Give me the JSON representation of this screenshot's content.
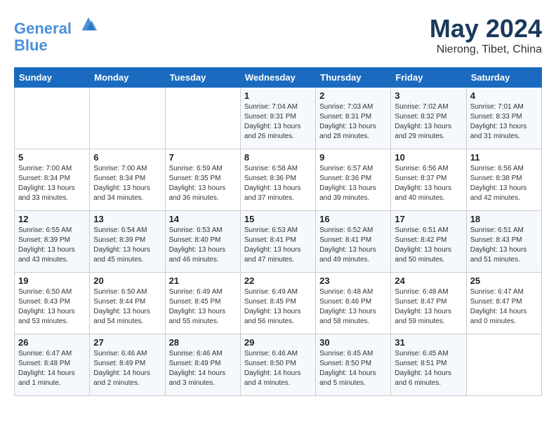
{
  "header": {
    "logo_line1": "General",
    "logo_line2": "Blue",
    "month_title": "May 2024",
    "subtitle": "Nierong, Tibet, China"
  },
  "days_of_week": [
    "Sunday",
    "Monday",
    "Tuesday",
    "Wednesday",
    "Thursday",
    "Friday",
    "Saturday"
  ],
  "weeks": [
    [
      {
        "day": "",
        "info": ""
      },
      {
        "day": "",
        "info": ""
      },
      {
        "day": "",
        "info": ""
      },
      {
        "day": "1",
        "info": "Sunrise: 7:04 AM\nSunset: 8:31 PM\nDaylight: 13 hours\nand 26 minutes."
      },
      {
        "day": "2",
        "info": "Sunrise: 7:03 AM\nSunset: 8:31 PM\nDaylight: 13 hours\nand 28 minutes."
      },
      {
        "day": "3",
        "info": "Sunrise: 7:02 AM\nSunset: 8:32 PM\nDaylight: 13 hours\nand 29 minutes."
      },
      {
        "day": "4",
        "info": "Sunrise: 7:01 AM\nSunset: 8:33 PM\nDaylight: 13 hours\nand 31 minutes."
      }
    ],
    [
      {
        "day": "5",
        "info": "Sunrise: 7:00 AM\nSunset: 8:34 PM\nDaylight: 13 hours\nand 33 minutes."
      },
      {
        "day": "6",
        "info": "Sunrise: 7:00 AM\nSunset: 8:34 PM\nDaylight: 13 hours\nand 34 minutes."
      },
      {
        "day": "7",
        "info": "Sunrise: 6:59 AM\nSunset: 8:35 PM\nDaylight: 13 hours\nand 36 minutes."
      },
      {
        "day": "8",
        "info": "Sunrise: 6:58 AM\nSunset: 8:36 PM\nDaylight: 13 hours\nand 37 minutes."
      },
      {
        "day": "9",
        "info": "Sunrise: 6:57 AM\nSunset: 8:36 PM\nDaylight: 13 hours\nand 39 minutes."
      },
      {
        "day": "10",
        "info": "Sunrise: 6:56 AM\nSunset: 8:37 PM\nDaylight: 13 hours\nand 40 minutes."
      },
      {
        "day": "11",
        "info": "Sunrise: 6:56 AM\nSunset: 8:38 PM\nDaylight: 13 hours\nand 42 minutes."
      }
    ],
    [
      {
        "day": "12",
        "info": "Sunrise: 6:55 AM\nSunset: 8:39 PM\nDaylight: 13 hours\nand 43 minutes."
      },
      {
        "day": "13",
        "info": "Sunrise: 6:54 AM\nSunset: 8:39 PM\nDaylight: 13 hours\nand 45 minutes."
      },
      {
        "day": "14",
        "info": "Sunrise: 6:53 AM\nSunset: 8:40 PM\nDaylight: 13 hours\nand 46 minutes."
      },
      {
        "day": "15",
        "info": "Sunrise: 6:53 AM\nSunset: 8:41 PM\nDaylight: 13 hours\nand 47 minutes."
      },
      {
        "day": "16",
        "info": "Sunrise: 6:52 AM\nSunset: 8:41 PM\nDaylight: 13 hours\nand 49 minutes."
      },
      {
        "day": "17",
        "info": "Sunrise: 6:51 AM\nSunset: 8:42 PM\nDaylight: 13 hours\nand 50 minutes."
      },
      {
        "day": "18",
        "info": "Sunrise: 6:51 AM\nSunset: 8:43 PM\nDaylight: 13 hours\nand 51 minutes."
      }
    ],
    [
      {
        "day": "19",
        "info": "Sunrise: 6:50 AM\nSunset: 8:43 PM\nDaylight: 13 hours\nand 53 minutes."
      },
      {
        "day": "20",
        "info": "Sunrise: 6:50 AM\nSunset: 8:44 PM\nDaylight: 13 hours\nand 54 minutes."
      },
      {
        "day": "21",
        "info": "Sunrise: 6:49 AM\nSunset: 8:45 PM\nDaylight: 13 hours\nand 55 minutes."
      },
      {
        "day": "22",
        "info": "Sunrise: 6:49 AM\nSunset: 8:45 PM\nDaylight: 13 hours\nand 56 minutes."
      },
      {
        "day": "23",
        "info": "Sunrise: 6:48 AM\nSunset: 8:46 PM\nDaylight: 13 hours\nand 58 minutes."
      },
      {
        "day": "24",
        "info": "Sunrise: 6:48 AM\nSunset: 8:47 PM\nDaylight: 13 hours\nand 59 minutes."
      },
      {
        "day": "25",
        "info": "Sunrise: 6:47 AM\nSunset: 8:47 PM\nDaylight: 14 hours\nand 0 minutes."
      }
    ],
    [
      {
        "day": "26",
        "info": "Sunrise: 6:47 AM\nSunset: 8:48 PM\nDaylight: 14 hours\nand 1 minute."
      },
      {
        "day": "27",
        "info": "Sunrise: 6:46 AM\nSunset: 8:49 PM\nDaylight: 14 hours\nand 2 minutes."
      },
      {
        "day": "28",
        "info": "Sunrise: 6:46 AM\nSunset: 8:49 PM\nDaylight: 14 hours\nand 3 minutes."
      },
      {
        "day": "29",
        "info": "Sunrise: 6:46 AM\nSunset: 8:50 PM\nDaylight: 14 hours\nand 4 minutes."
      },
      {
        "day": "30",
        "info": "Sunrise: 6:45 AM\nSunset: 8:50 PM\nDaylight: 14 hours\nand 5 minutes."
      },
      {
        "day": "31",
        "info": "Sunrise: 6:45 AM\nSunset: 8:51 PM\nDaylight: 14 hours\nand 6 minutes."
      },
      {
        "day": "",
        "info": ""
      }
    ]
  ]
}
